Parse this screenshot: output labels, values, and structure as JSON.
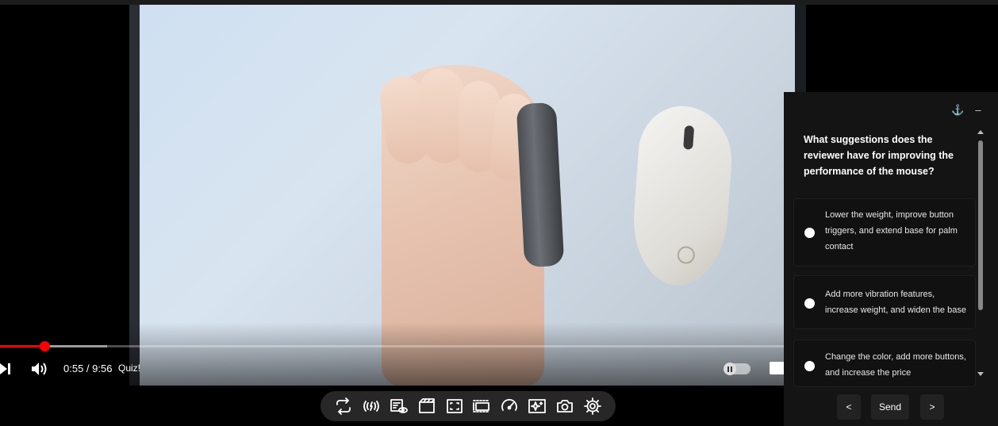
{
  "player": {
    "time_display": "0:55 / 9:56",
    "quiz_label": "Quiz!",
    "progress_played_fraction": 0.0563,
    "progress_loaded_fraction": 0.137,
    "accent_color": "#ff0000"
  },
  "toolbar": {
    "buttons": [
      {
        "name": "loop-icon"
      },
      {
        "name": "audio-wave-icon"
      },
      {
        "name": "watch-later-icon"
      },
      {
        "name": "cinema-mode-icon"
      },
      {
        "name": "picture-in-picture-icon"
      },
      {
        "name": "theater-mode-icon"
      },
      {
        "name": "playback-speed-icon"
      },
      {
        "name": "ai-enhance-icon"
      },
      {
        "name": "screenshot-icon"
      },
      {
        "name": "settings-icon"
      }
    ]
  },
  "quiz": {
    "question": "What suggestions does the reviewer have for improving the performance of the mouse?",
    "options": [
      {
        "text": "Lower the weight, improve button triggers, and extend base for palm contact"
      },
      {
        "text": "Add more vibration features, increase weight, and widen the base"
      },
      {
        "text": "Change the color, add more buttons, and increase the price"
      }
    ],
    "prev_label": "<",
    "send_label": "Send",
    "next_label": ">",
    "anchor_glyph": "⚓",
    "minimize_glyph": "–"
  }
}
